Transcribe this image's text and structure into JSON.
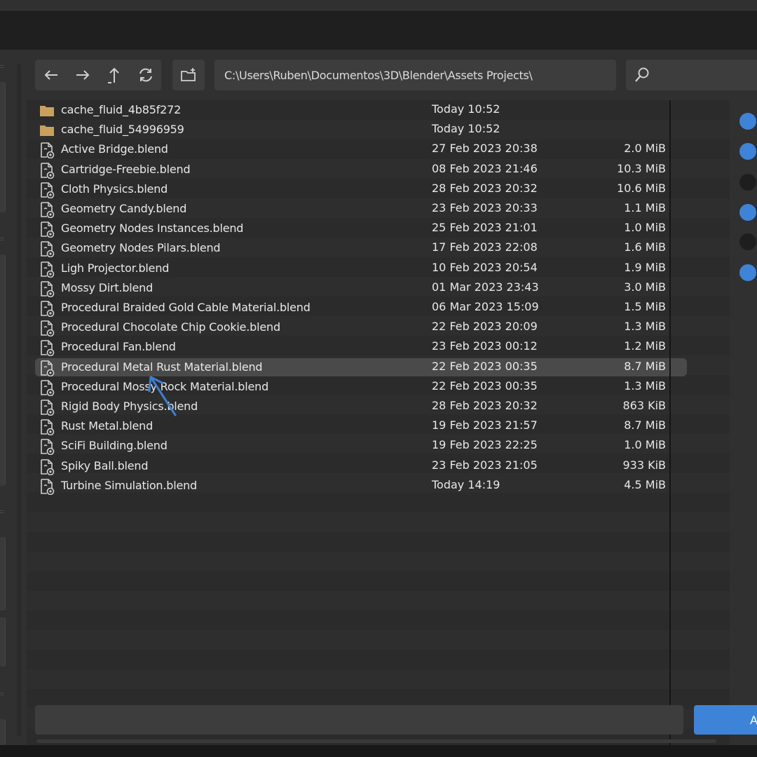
{
  "toolbar": {
    "path": "C:\\Users\\Ruben\\Documentos\\3D\\Blender\\Assets Projects\\",
    "nav_buttons": [
      {
        "icon": "back-arrow-icon"
      },
      {
        "icon": "forward-arrow-icon"
      },
      {
        "icon": "parent-directory-icon"
      },
      {
        "icon": "refresh-icon"
      }
    ],
    "new_directory_icon": "new-folder-icon",
    "search_icon": "magnifier-icon"
  },
  "files": [
    {
      "name": "cache_fluid_4b85f272",
      "date": "Today 10:52",
      "size": "",
      "type": "folder"
    },
    {
      "name": "cache_fluid_54996959",
      "date": "Today 10:52",
      "size": "",
      "type": "folder"
    },
    {
      "name": "Active Bridge.blend",
      "date": "27 Feb 2023 20:38",
      "size": "2.0 MiB",
      "type": "blend"
    },
    {
      "name": "Cartridge-Freebie.blend",
      "date": "08 Feb 2023 21:46",
      "size": "10.3 MiB",
      "type": "blend"
    },
    {
      "name": "Cloth Physics.blend",
      "date": "28 Feb 2023 20:32",
      "size": "10.6 MiB",
      "type": "blend"
    },
    {
      "name": "Geometry Candy.blend",
      "date": "23 Feb 2023 20:33",
      "size": "1.1 MiB",
      "type": "blend"
    },
    {
      "name": "Geometry Nodes Instances.blend",
      "date": "25 Feb 2023 21:01",
      "size": "1.0 MiB",
      "type": "blend"
    },
    {
      "name": "Geometry Nodes Pilars.blend",
      "date": "17 Feb 2023 22:08",
      "size": "1.6 MiB",
      "type": "blend"
    },
    {
      "name": "Ligh Projector.blend",
      "date": "10 Feb 2023 20:54",
      "size": "1.9 MiB",
      "type": "blend"
    },
    {
      "name": "Mossy Dirt.blend",
      "date": "01 Mar 2023 23:43",
      "size": "3.0 MiB",
      "type": "blend"
    },
    {
      "name": "Procedural Braided Gold Cable Material.blend",
      "date": "06 Mar 2023 15:09",
      "size": "1.5 MiB",
      "type": "blend"
    },
    {
      "name": "Procedural Chocolate Chip Cookie.blend",
      "date": "22 Feb 2023 20:09",
      "size": "1.3 MiB",
      "type": "blend"
    },
    {
      "name": "Procedural Fan.blend",
      "date": "23 Feb 2023 00:12",
      "size": "1.2 MiB",
      "type": "blend"
    },
    {
      "name": "Procedural Metal Rust Material.blend",
      "date": "22 Feb 2023 00:35",
      "size": "8.7 MiB",
      "type": "blend",
      "selected": true
    },
    {
      "name": "Procedural Mossy Rock Material.blend",
      "date": "22 Feb 2023 00:35",
      "size": "1.3 MiB",
      "type": "blend"
    },
    {
      "name": "Rigid Body Physics.blend",
      "date": "28 Feb 2023 20:32",
      "size": "863 KiB",
      "type": "blend"
    },
    {
      "name": "Rust Metal.blend",
      "date": "19 Feb 2023 21:57",
      "size": "8.7 MiB",
      "type": "blend"
    },
    {
      "name": "SciFi Building.blend",
      "date": "19 Feb 2023 22:25",
      "size": "1.0 MiB",
      "type": "blend"
    },
    {
      "name": "Spiky Ball.blend",
      "date": "23 Feb 2023 21:05",
      "size": "933 KiB",
      "type": "blend"
    },
    {
      "name": "Turbine Simulation.blend",
      "date": "Today 14:19",
      "size": "4.5 MiB",
      "type": "blend"
    }
  ],
  "options": [
    {
      "checked": true
    },
    {
      "checked": true
    },
    {
      "checked": false
    },
    {
      "checked": true
    },
    {
      "checked": false
    },
    {
      "checked": true
    }
  ],
  "footer": {
    "filename_value": "",
    "accept_label": "A"
  },
  "colors": {
    "accent": "#3d84d9",
    "background": "#303030",
    "list_background": "#2b2b2b",
    "folder": "#c9a15c"
  }
}
